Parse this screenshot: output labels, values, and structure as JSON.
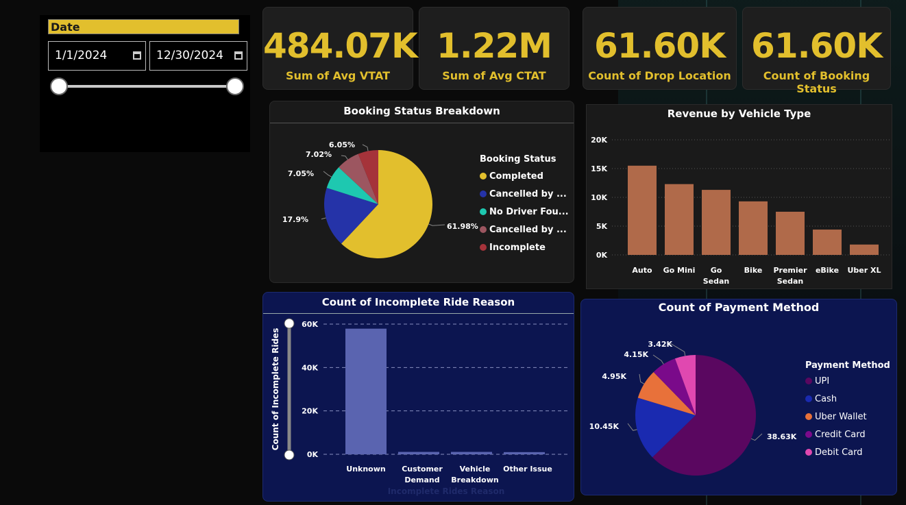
{
  "slicer": {
    "title": "Date",
    "start": "1/1/2024",
    "end": "12/30/2024"
  },
  "kpis": [
    {
      "value": "484.07K",
      "label": "Sum of Avg VTAT"
    },
    {
      "value": "1.22M",
      "label": "Sum of Avg CTAT"
    },
    {
      "value": "61.60K",
      "label": "Count of Drop Location"
    },
    {
      "value": "61.60K",
      "label": "Count of Booking Status"
    }
  ],
  "booking": {
    "legend_title": "Booking Status",
    "legend": [
      {
        "label": "Completed",
        "color": "#e2bf2d"
      },
      {
        "label": "Cancelled by ...",
        "color": "#2533a8"
      },
      {
        "label": "No Driver Fou...",
        "color": "#1ec8b0"
      },
      {
        "label": "Cancelled by ...",
        "color": "#9c5660"
      },
      {
        "label": "Incomplete",
        "color": "#a5333a"
      }
    ]
  },
  "payment": {
    "legend_title": "Payment Method",
    "legend": [
      {
        "label": "UPI",
        "color": "#5a0760"
      },
      {
        "label": "Cash",
        "color": "#1a2ab0"
      },
      {
        "label": "Uber Wallet",
        "color": "#e8713a"
      },
      {
        "label": "Credit Card",
        "color": "#7a0a8a"
      },
      {
        "label": "Debit Card",
        "color": "#e048b0"
      }
    ]
  },
  "chart_data": [
    {
      "type": "pie",
      "title": "Booking Status Breakdown",
      "categories": [
        "Completed",
        "Cancelled by ...",
        "No Driver Fou...",
        "Cancelled by ...",
        "Incomplete"
      ],
      "values": [
        61.98,
        17.9,
        7.05,
        7.02,
        6.05
      ],
      "labels": [
        "61.98%",
        "17.9%",
        "7.05%",
        "7.02%",
        "6.05%"
      ],
      "colors": [
        "#e2bf2d",
        "#2533a8",
        "#1ec8b0",
        "#9c5660",
        "#a5333a"
      ]
    },
    {
      "type": "bar",
      "title": "Revenue by Vehicle Type",
      "categories": [
        "Auto",
        "Go Mini",
        "Go Sedan",
        "Bike",
        "Premier Sedan",
        "eBike",
        "Uber XL"
      ],
      "values": [
        15500,
        12300,
        11300,
        9300,
        7500,
        4400,
        1800
      ],
      "ylim": [
        0,
        20000
      ],
      "yticks": [
        "0K",
        "5K",
        "10K",
        "15K",
        "20K"
      ],
      "color": "#b06a4a",
      "grid": true
    },
    {
      "type": "bar",
      "title": "Count of Incomplete Ride Reason",
      "categories": [
        "Unknown",
        "Customer Demand",
        "Vehicle Breakdown",
        "Other Issue"
      ],
      "values": [
        57900,
        1100,
        1100,
        1000
      ],
      "xlabel": "Incomplete Rides Reason",
      "ylabel": "Count of Incomplete Rides",
      "ylim": [
        0,
        60000
      ],
      "yticks": [
        "0K",
        "20K",
        "40K",
        "60K"
      ],
      "color": "#5a64b0",
      "grid": true
    },
    {
      "type": "pie",
      "title": "Count of Payment Method",
      "categories": [
        "UPI",
        "Cash",
        "Uber Wallet",
        "Credit Card",
        "Debit Card"
      ],
      "values": [
        38.63,
        10.45,
        4.95,
        4.15,
        3.42
      ],
      "labels": [
        "38.63K",
        "10.45K",
        "4.95K",
        "4.15K",
        "3.42K"
      ],
      "colors": [
        "#5a0760",
        "#1a2ab0",
        "#e8713a",
        "#7a0a8a",
        "#e048b0"
      ]
    }
  ]
}
